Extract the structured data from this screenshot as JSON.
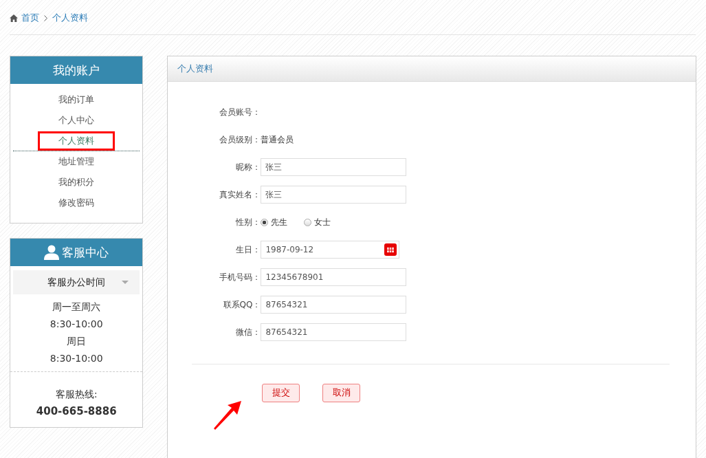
{
  "breadcrumb": [
    {
      "label": "首页",
      "kind": "home"
    },
    {
      "label": "个人资料",
      "kind": "link"
    }
  ],
  "account_menu": {
    "title": "我的账户",
    "items": [
      {
        "label": "我的订单",
        "selected": false
      },
      {
        "label": "个人中心",
        "selected": false
      },
      {
        "label": "个人资料",
        "selected": true
      },
      {
        "label": "地址管理",
        "selected": false
      },
      {
        "label": "我的积分",
        "selected": false
      },
      {
        "label": "修改密码",
        "selected": false
      }
    ]
  },
  "service_center": {
    "title": "客服中心",
    "dropdown": "客服办公时间",
    "hours": [
      "周一至周六",
      "8:30-10:00",
      "周日",
      "8:30-10:00"
    ],
    "hotline_label": "客服热线:",
    "hotline": "400-665-8886"
  },
  "panel": {
    "title": "个人资料"
  },
  "form": {
    "fields": [
      {
        "kind": "static",
        "label": "会员账号："
      },
      {
        "kind": "static",
        "label": "会员级别：",
        "value": "普通会员"
      },
      {
        "kind": "input",
        "label": "昵称：",
        "value": "张三"
      },
      {
        "kind": "input",
        "label": "真实姓名：",
        "value": "张三"
      },
      {
        "kind": "radio",
        "label": "性别：",
        "options": [
          {
            "label": "先生",
            "selected": true
          },
          {
            "label": "女士",
            "selected": false
          }
        ]
      },
      {
        "kind": "date",
        "label": "生日：",
        "value": "1987-09-12"
      },
      {
        "kind": "input",
        "label": "手机号码：",
        "value": "12345678901"
      },
      {
        "kind": "input",
        "label": "联系QQ：",
        "value": "87654321"
      },
      {
        "kind": "input",
        "label": "微信：",
        "value": "87654321"
      }
    ],
    "buttons": [
      "提交",
      "取消"
    ]
  }
}
